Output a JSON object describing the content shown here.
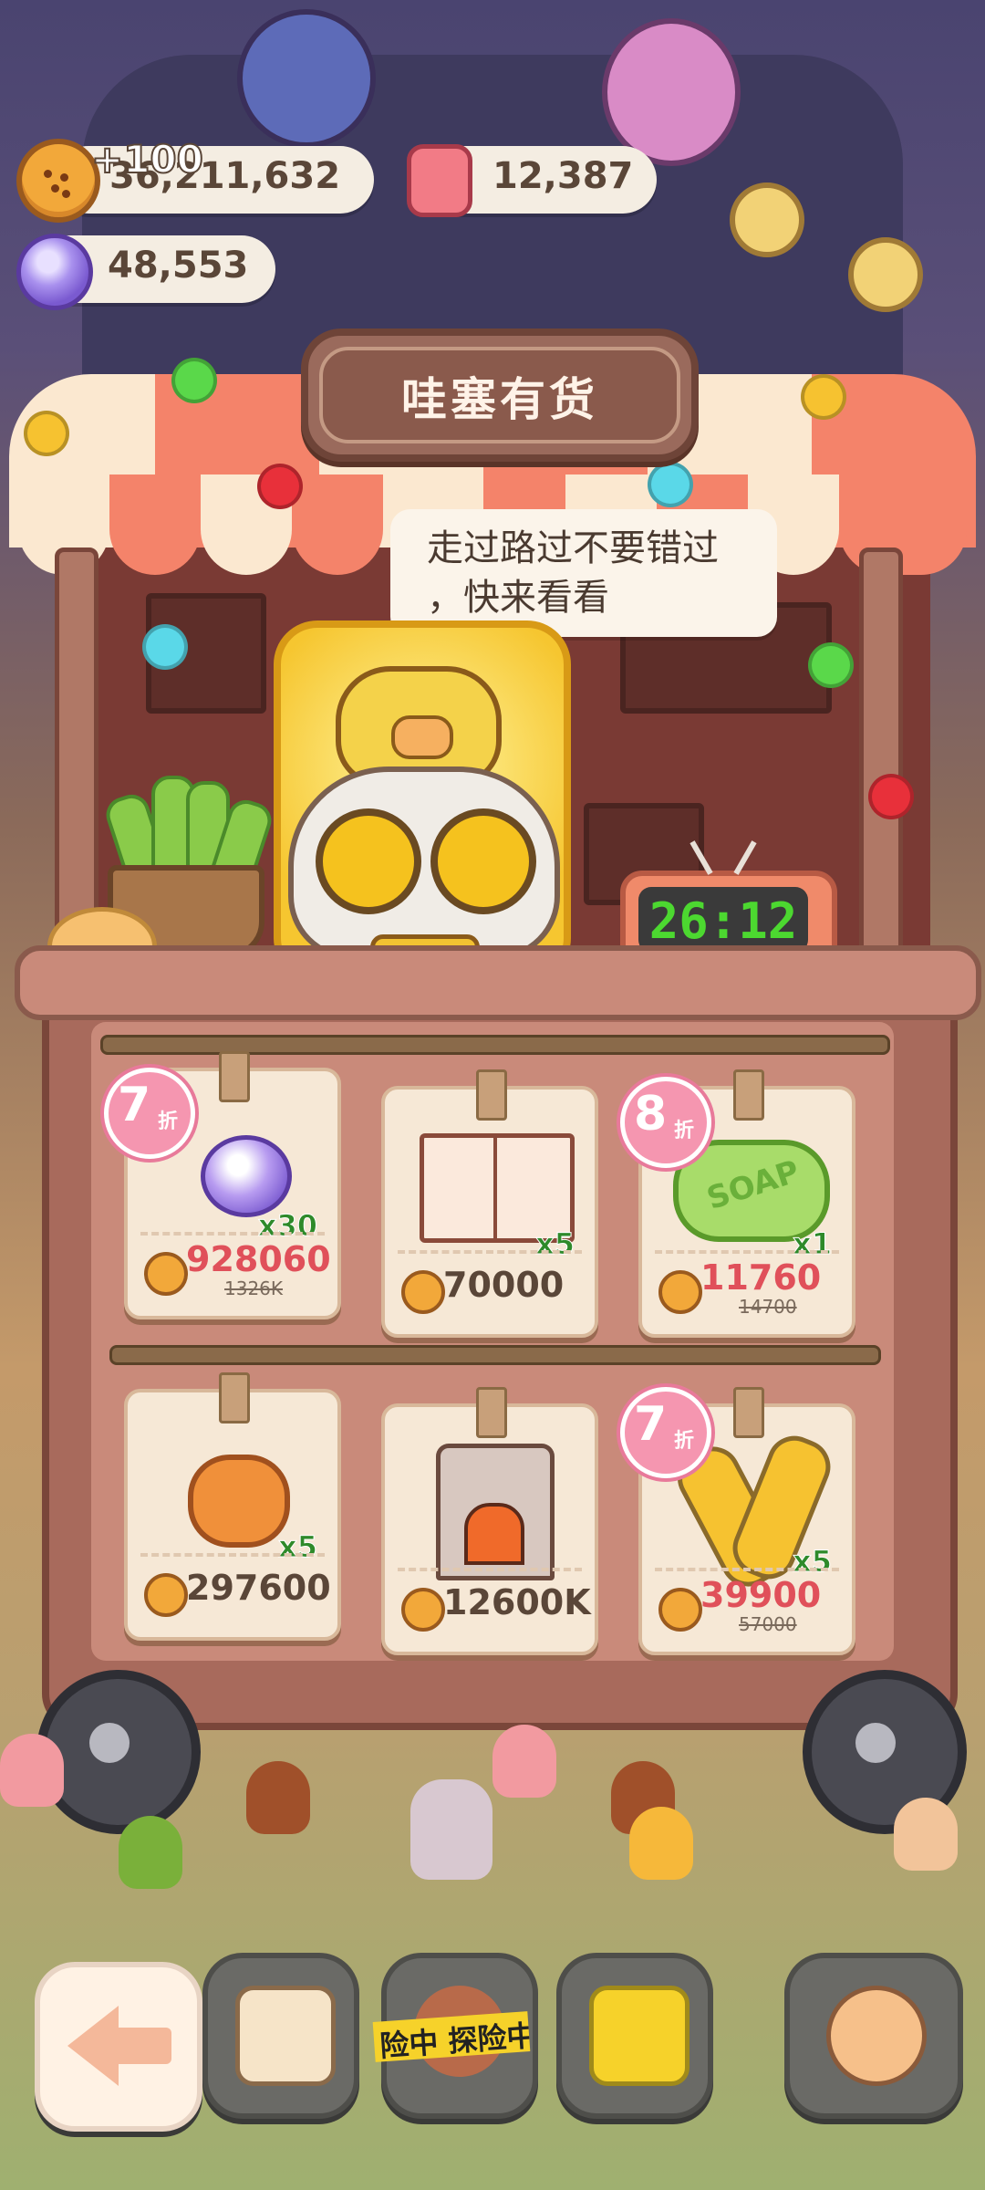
{
  "currency": {
    "cookies": "36,211,632",
    "cookies_gain": "+100",
    "candles": "12,387",
    "crystals": "48,553"
  },
  "shop": {
    "title": "哇塞有货",
    "speech_line1": "走过路过不要错过",
    "speech_line2": "，快来看看",
    "timer": "26:12"
  },
  "items": [
    {
      "name": "candy-crystal",
      "qty": "x30",
      "badge_num": "7",
      "badge_unit": "折",
      "price": "928060",
      "old_price": "1326K"
    },
    {
      "name": "sketchbook",
      "qty": "x5",
      "price": "70000"
    },
    {
      "name": "soap",
      "qty": "x1",
      "badge_num": "8",
      "badge_unit": "折",
      "price": "11760",
      "old_price": "14700",
      "label": "SOAP"
    },
    {
      "name": "bread",
      "qty": "x5",
      "price": "297600"
    },
    {
      "name": "fireplace",
      "price": "12600K"
    },
    {
      "name": "spoon-fork",
      "qty": "x5",
      "badge_num": "7",
      "badge_unit": "折",
      "price": "39900",
      "old_price": "57000"
    }
  ],
  "nav": {
    "tape_text": "险中 探险中"
  },
  "icons": [
    "cookie-icon",
    "candle-icon",
    "crystal-icon",
    "back-arrow-icon",
    "notebook-icon",
    "expedition-icon",
    "shop-bag-icon",
    "alarm-clock-icon"
  ],
  "colors": {
    "discount_price": "#e0505a",
    "timer_digits": "#4cd830",
    "badge": "#f596b0"
  }
}
